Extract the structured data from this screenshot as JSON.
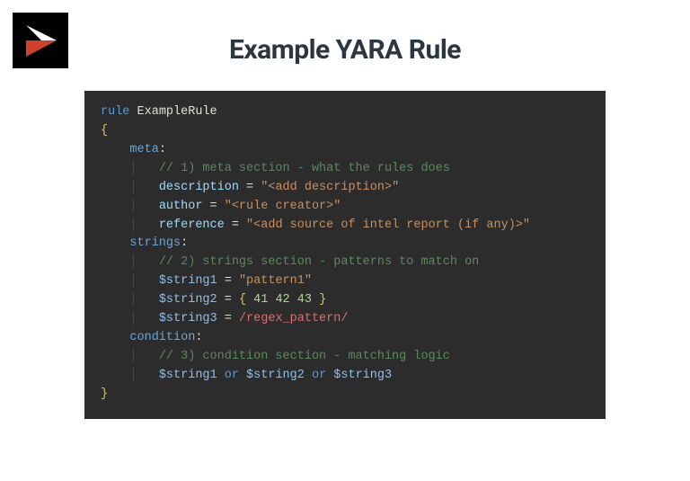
{
  "title": "Example YARA Rule",
  "logo": {
    "name": "play-triangle-logo"
  },
  "code": {
    "keyword_rule": "rule",
    "rule_name": "ExampleRule",
    "open_brace": "{",
    "close_brace": "}",
    "sections": {
      "meta": {
        "label": "meta",
        "comment": "// 1) meta section - what the rules does",
        "description_key": "description",
        "description_val": "\"<add description>\"",
        "author_key": "author",
        "author_val": "\"<rule creator>\"",
        "reference_key": "reference",
        "reference_val": "\"<add source of intel report (if any)>\""
      },
      "strings": {
        "label": "strings",
        "comment": "// 2) strings section - patterns to match on",
        "s1_var": "$string1",
        "s1_val": "\"pattern1\"",
        "s2_var": "$string2",
        "s2_hex_open": "{",
        "s2_hex": " 41 42 43 ",
        "s2_hex_close": "}",
        "s3_var": "$string3",
        "s3_regex": "/regex_pattern/"
      },
      "condition": {
        "label": "condition",
        "comment": "// 3) condition section - matching logic",
        "c1": "$string1",
        "op1": "or",
        "c2": "$string2",
        "op2": "or",
        "c3": "$string3"
      }
    },
    "equals": " = ",
    "colon": ":"
  }
}
